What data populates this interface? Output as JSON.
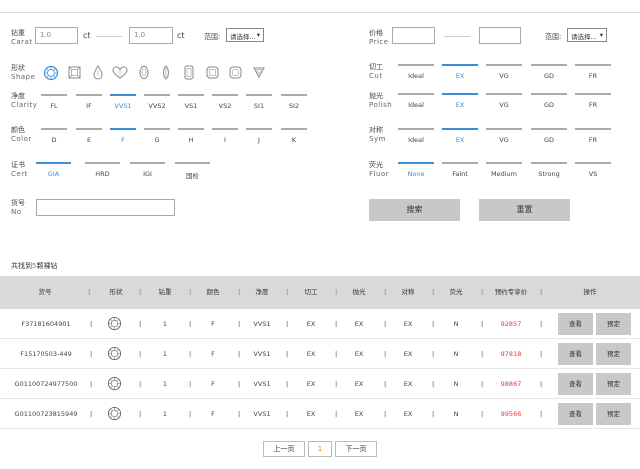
{
  "filters": {
    "carat": {
      "label_cn": "钻重",
      "label_en": "Carat",
      "min_value": "1.0",
      "max_value": "1.0",
      "unit": "ct",
      "range_label": "范围:",
      "range_select": "请选择..."
    },
    "price": {
      "label_cn": "价格",
      "label_en": "Price",
      "min_value": "",
      "max_value": "",
      "range_label": "范围:",
      "range_select": "请选择..."
    },
    "shape": {
      "label_cn": "形状",
      "label_en": "Shape",
      "icons": [
        "round-diamond",
        "princess-square",
        "pear",
        "heart",
        "oval",
        "marquise",
        "emerald-rect",
        "asscher-square",
        "cushion",
        "trillion"
      ]
    },
    "clarity": {
      "label_cn": "净度",
      "label_en": "Clarity",
      "options": [
        "FL",
        "IF",
        "VVS1",
        "VVS2",
        "VS1",
        "VS2",
        "SI1",
        "SI2"
      ],
      "selected": "VVS1"
    },
    "color": {
      "label_cn": "颜色",
      "label_en": "Color",
      "options": [
        "D",
        "E",
        "F",
        "G",
        "H",
        "I",
        "J",
        "K"
      ],
      "selected": "F"
    },
    "cert": {
      "label_cn": "证书",
      "label_en": "Cert",
      "options": [
        "GIA",
        "HRD",
        "IGI",
        "国检"
      ],
      "selected": "GIA"
    },
    "stock_no": {
      "label_cn": "货号",
      "label_en": "No",
      "value": ""
    },
    "cut": {
      "label_cn": "切工",
      "label_en": "Cut",
      "options": [
        "Ideal",
        "EX",
        "VG",
        "GD",
        "FR"
      ],
      "selected": "EX"
    },
    "polish": {
      "label_cn": "抛光",
      "label_en": "Polish",
      "options": [
        "Ideal",
        "EX",
        "VG",
        "GD",
        "FR"
      ],
      "selected": "EX"
    },
    "sym": {
      "label_cn": "对称",
      "label_en": "Sym",
      "options": [
        "Ideal",
        "EX",
        "VG",
        "GD",
        "FR"
      ],
      "selected": "EX"
    },
    "fluor": {
      "label_cn": "荧光",
      "label_en": "Fluor",
      "options": [
        "None",
        "Faint",
        "Medium",
        "Strong",
        "VS"
      ],
      "selected": "None"
    }
  },
  "actions": {
    "search": "搜索",
    "reset": "重置"
  },
  "summary": {
    "prefix": "共找到",
    "count": "5",
    "suffix": "颗裸钻"
  },
  "table": {
    "headers": [
      "货号",
      "形状",
      "钻重",
      "颜色",
      "净度",
      "切工",
      "抛光",
      "对称",
      "荧光",
      "预约专享价",
      "操作"
    ],
    "rows": [
      {
        "no": "F37181604901",
        "shape": "round-diamond",
        "carat": "1",
        "color": "F",
        "clarity": "VVS1",
        "cut": "EX",
        "polish": "EX",
        "sym": "EX",
        "fluor": "N",
        "price": "92857"
      },
      {
        "no": "F15170503-449",
        "shape": "round-diamond",
        "carat": "1",
        "color": "F",
        "clarity": "VVS1",
        "cut": "EX",
        "polish": "EX",
        "sym": "EX",
        "fluor": "N",
        "price": "97818"
      },
      {
        "no": "G01100724977500",
        "shape": "round-diamond",
        "carat": "1",
        "color": "F",
        "clarity": "VVS1",
        "cut": "EX",
        "polish": "EX",
        "sym": "EX",
        "fluor": "N",
        "price": "98867"
      },
      {
        "no": "G01100723815949",
        "shape": "round-diamond",
        "carat": "1",
        "color": "F",
        "clarity": "VVS1",
        "cut": "EX",
        "polish": "EX",
        "sym": "EX",
        "fluor": "N",
        "price": "99566"
      }
    ],
    "row_actions": {
      "view": "查看",
      "reserve": "预定"
    }
  },
  "pagination": {
    "prev": "上一页",
    "current": "1",
    "next": "下一页"
  },
  "colors": {
    "accent": "#3a8fdc",
    "price": "#e23b3b",
    "button_gray": "#c8c8c8",
    "header_gray": "#d9d9d9",
    "current_page": "#e8891c"
  }
}
